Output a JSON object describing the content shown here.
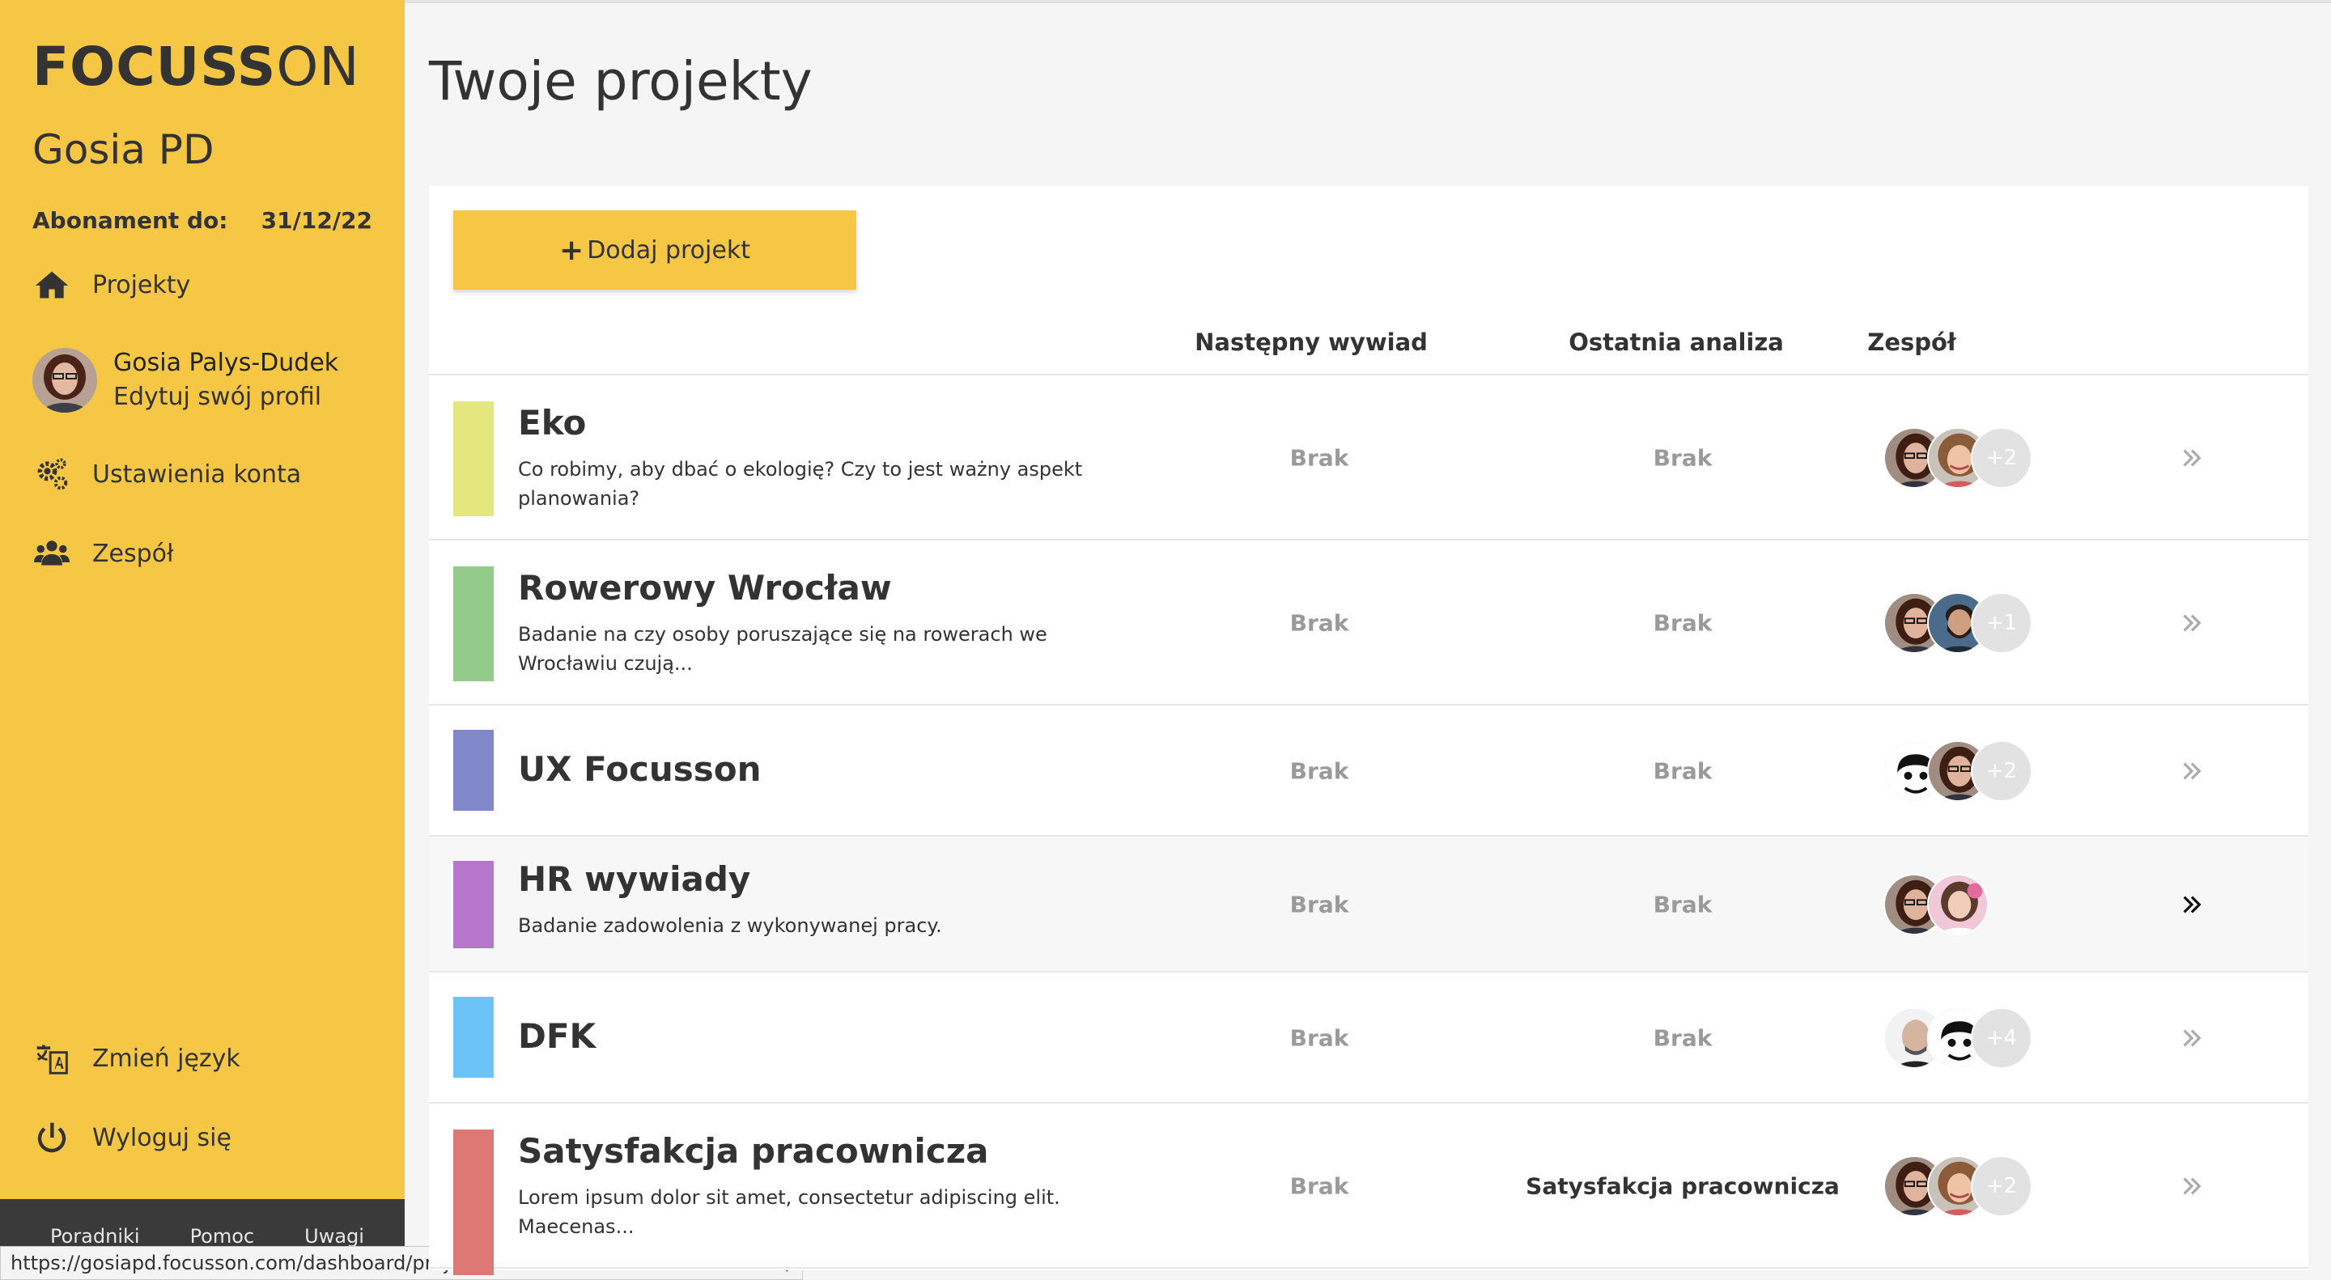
{
  "sidebar": {
    "logo_bold": "FOCUSS",
    "logo_light": "ON",
    "user_short": "Gosia PD",
    "subscription_label": "Abonament do:",
    "subscription_date": "31/12/22",
    "nav": {
      "projects": "Projekty",
      "settings": "Ustawienia konta",
      "team": "Zespół",
      "language": "Zmień język",
      "logout": "Wyloguj się"
    },
    "profile": {
      "name": "Gosia Palys-Dudek",
      "edit": "Edytuj swój profil"
    },
    "footer": {
      "guides": "Poradniki",
      "help": "Pomoc",
      "notes": "Uwagi"
    }
  },
  "status_url": "https://gosiapd.focusson.com/dashboard/projects/5e60e5ebbfd6d417008b456b/",
  "main": {
    "title": "Twoje projekty",
    "add_button": "Dodaj projekt",
    "columns": {
      "next_interview": "Następny wywiad",
      "last_analysis": "Ostatnia analiza",
      "team": "Zespół"
    },
    "projects": [
      {
        "title": "Eko",
        "description": "Co robimy, aby dbać o ekologię? Czy to jest ważny aspekt planowania?",
        "color": "#e4e67e",
        "next_interview": "Brak",
        "last_analysis": "Brak",
        "avatars": [
          "woman-glasses",
          "woman-curly"
        ],
        "more": "+2"
      },
      {
        "title": "Rowerowy Wrocław",
        "description": "Badanie na czy osoby poruszające się na rowerach we Wrocławiu czują...",
        "color": "#93cb8b",
        "next_interview": "Brak",
        "last_analysis": "Brak",
        "avatars": [
          "woman-glasses",
          "man-beard"
        ],
        "more": "+1"
      },
      {
        "title": "UX Focusson",
        "description": "",
        "color": "#8088cb",
        "next_interview": "Brak",
        "last_analysis": "Brak",
        "avatars": [
          "cartoon-face",
          "woman-glasses"
        ],
        "more": "+2"
      },
      {
        "title": "HR wywiady",
        "description": "Badanie zadowolenia z wykonywanej pracy.",
        "color": "#b576cc",
        "next_interview": "Brak",
        "last_analysis": "Brak",
        "avatars": [
          "woman-glasses",
          "woman-pink"
        ],
        "more": ""
      },
      {
        "title": "DFK",
        "description": "",
        "color": "#6cc3f5",
        "next_interview": "Brak",
        "last_analysis": "Brak",
        "avatars": [
          "man-bald",
          "cartoon-face"
        ],
        "more": "+4"
      },
      {
        "title": "Satysfakcja pracownicza",
        "description": "Lorem ipsum dolor sit amet, consectetur adipiscing elit. Maecenas...",
        "color": "#dd7874",
        "next_interview": "Brak",
        "last_analysis": "Satysfakcja pracownicza",
        "avatars": [
          "woman-glasses",
          "woman-curly"
        ],
        "more": "+2"
      }
    ]
  }
}
